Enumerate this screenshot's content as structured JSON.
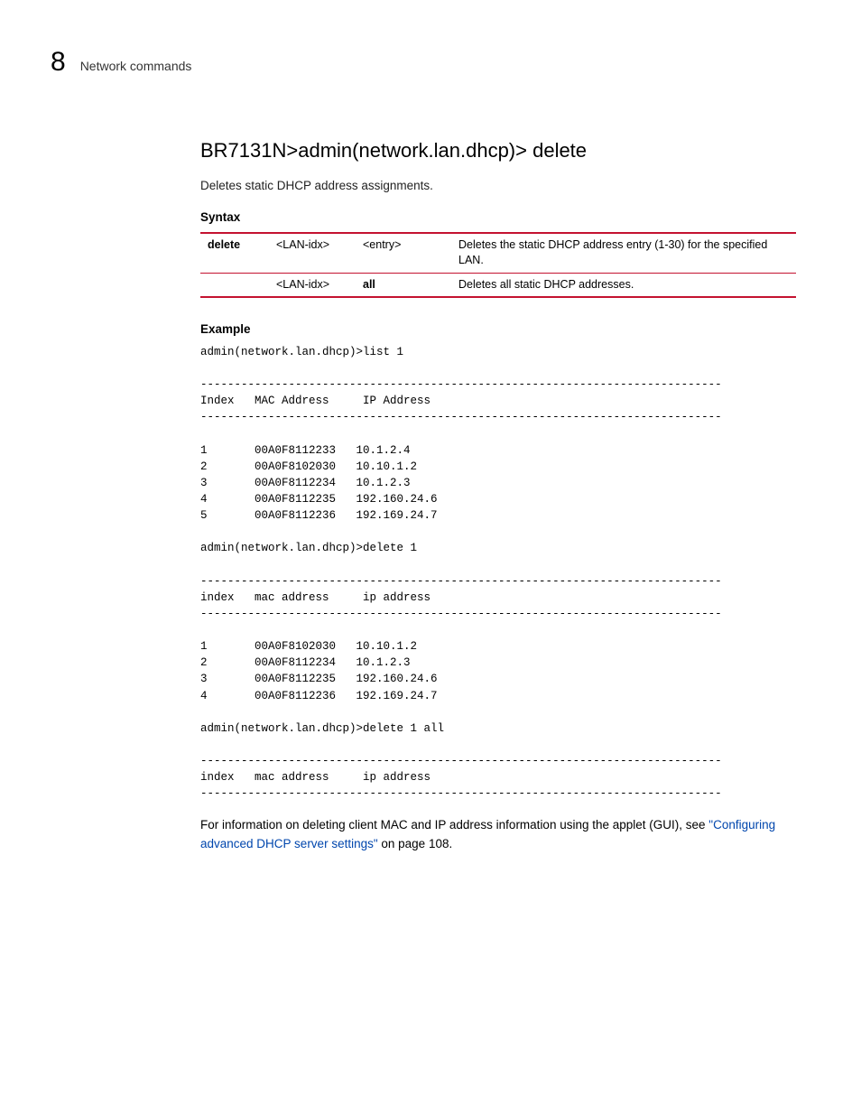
{
  "header": {
    "chapterNumber": "8",
    "chapterTitle": "Network commands"
  },
  "section": {
    "title": "BR7131N>admin(network.lan.dhcp)> delete",
    "description": "Deletes static DHCP address assignments."
  },
  "syntax": {
    "heading": "Syntax",
    "rows": [
      {
        "c1": "delete",
        "c2": "<LAN-idx>",
        "c3": "<entry>",
        "c4": "Deletes the static DHCP address entry (1-30) for the specified LAN."
      },
      {
        "c1": "",
        "c2": "<LAN-idx>",
        "c3": "all",
        "c4": "Deletes all static DHCP addresses."
      }
    ]
  },
  "example": {
    "heading": "Example",
    "code": "admin(network.lan.dhcp)>list 1\n\n-----------------------------------------------------------------------------\nIndex   MAC Address     IP Address\n-----------------------------------------------------------------------------\n\n1       00A0F8112233   10.1.2.4\n2       00A0F8102030   10.10.1.2\n3       00A0F8112234   10.1.2.3\n4       00A0F8112235   192.160.24.6\n5       00A0F8112236   192.169.24.7\n\nadmin(network.lan.dhcp)>delete 1\n\n-----------------------------------------------------------------------------\nindex   mac address     ip address\n-----------------------------------------------------------------------------\n\n1       00A0F8102030   10.10.1.2\n2       00A0F8112234   10.1.2.3\n3       00A0F8112235   192.160.24.6\n4       00A0F8112236   192.169.24.7\n\nadmin(network.lan.dhcp)>delete 1 all\n\n-----------------------------------------------------------------------------\nindex   mac address     ip address\n-----------------------------------------------------------------------------"
  },
  "footer": {
    "pre": "For information on deleting client MAC and IP address information using the applet (GUI), see ",
    "link": "\"Configuring advanced DHCP server settings\"",
    "post": " on page 108."
  }
}
